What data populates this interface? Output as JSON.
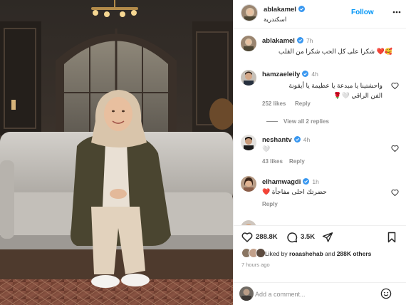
{
  "post_header": {
    "username": "ablakamel",
    "location": "اسكندرية",
    "follow_label": "Follow"
  },
  "comments": [
    {
      "username": "ablakamel",
      "time": "7h",
      "text": "🥰❤️ شكرا على كل الحب شكرا من القلب"
    },
    {
      "username": "hamzaeleily",
      "time": "4h",
      "text_line1": "واحشتينا يا مبدعة يا عظيمة يا أيقونة",
      "text_line2": "الفن الراقي 🤍🌹",
      "likes": "252 likes",
      "reply": "Reply"
    },
    {
      "username": "neshantv",
      "time": "4h",
      "text": "🤍",
      "likes": "43 likes",
      "reply": "Reply"
    },
    {
      "username": "elhamwagdi",
      "time": "1h",
      "text": "حضرتك احلى مفاجأة ❤️",
      "reply": "Reply"
    }
  ],
  "view_replies": "View all 2 replies",
  "actions": {
    "like_count": "288.8K",
    "comment_count": "3.5K",
    "liked_by_prefix": "Liked by",
    "liked_by_user": "roaashehab",
    "liked_by_and": "and",
    "liked_by_others": "288K others",
    "posted_time": "7 hours ago"
  },
  "add_comment": {
    "placeholder": "Add a comment..."
  },
  "colors": {
    "link_blue": "#0095f6",
    "verified_blue": "#3897f0",
    "muted": "#8e8e8e",
    "text": "#262626"
  },
  "icons": [
    "more-icon",
    "verified-icon",
    "heart-icon",
    "comment-icon",
    "share-icon",
    "bookmark-icon",
    "emoji-icon"
  ]
}
